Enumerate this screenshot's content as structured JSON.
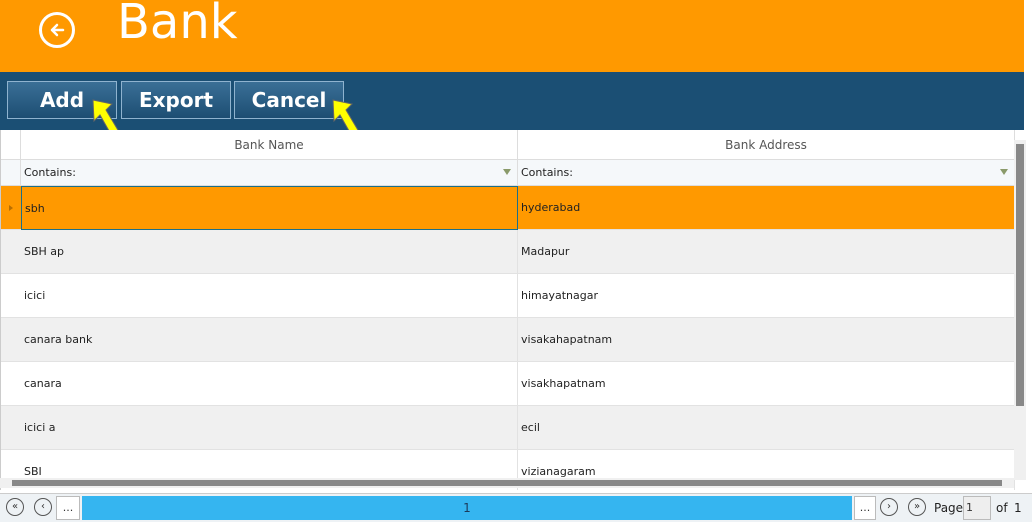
{
  "header": {
    "title": "Bank"
  },
  "toolbar": {
    "add_label": "Add",
    "export_label": "Export",
    "cancel_label": "Cancel"
  },
  "grid": {
    "columns": [
      "Bank Name",
      "Bank Address"
    ],
    "filter_label": "Contains:",
    "rows": [
      {
        "name": "sbh",
        "address": "hyderabad"
      },
      {
        "name": "SBH ap",
        "address": "Madapur"
      },
      {
        "name": "icici",
        "address": "himayatnagar"
      },
      {
        "name": "canara bank",
        "address": "visakahapatnam"
      },
      {
        "name": "canara",
        "address": "visakhapatnam"
      },
      {
        "name": "icici a",
        "address": "ecil"
      },
      {
        "name": "SBI",
        "address": "vizianagaram"
      }
    ]
  },
  "pager": {
    "ellipsis_left": "...",
    "current_page_number": "1",
    "ellipsis_right": "...",
    "page_label": "Page",
    "page_value": "1",
    "of_label": "of",
    "total_pages": "1"
  },
  "colors": {
    "header": "#ff9900",
    "toolbar": "#1b4f74",
    "selected_row": "#ff9900",
    "alt_row": "#f0f0f0",
    "pager_bar": "#35b5f0"
  }
}
